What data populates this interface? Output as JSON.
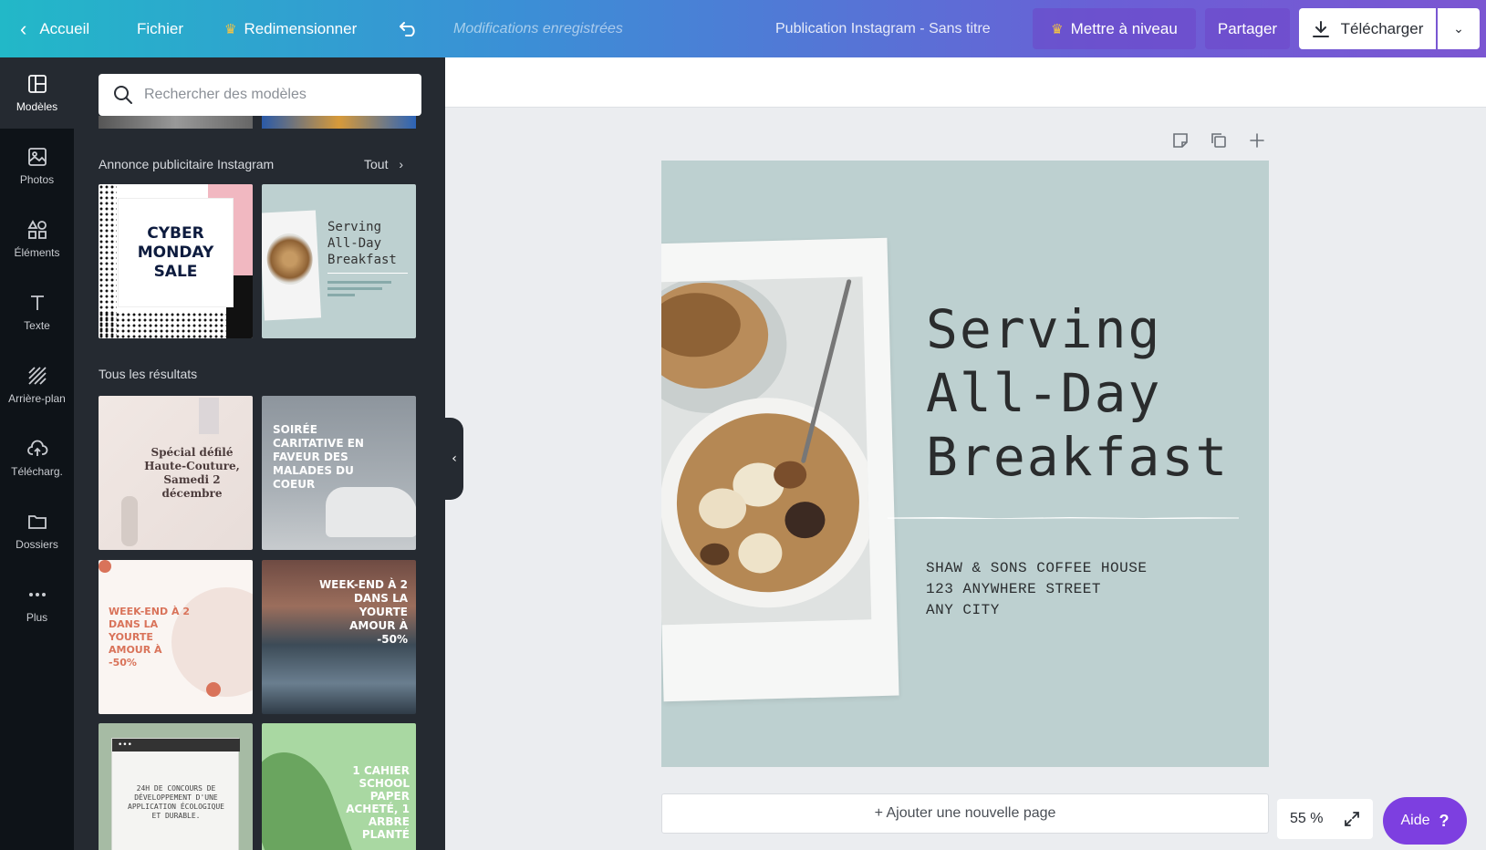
{
  "topbar": {
    "back_label": "Accueil",
    "file_label": "Fichier",
    "resize_label": "Redimensionner",
    "saved_status": "Modifications enregistrées",
    "document_title": "Publication Instagram - Sans titre",
    "upgrade_label": "Mettre à niveau",
    "share_label": "Partager",
    "download_label": "Télécharger"
  },
  "rail": {
    "items": [
      {
        "label": "Modèles",
        "icon": "templates-icon"
      },
      {
        "label": "Photos",
        "icon": "photos-icon"
      },
      {
        "label": "Éléments",
        "icon": "elements-icon"
      },
      {
        "label": "Texte",
        "icon": "text-icon"
      },
      {
        "label": "Arrière-plan",
        "icon": "background-icon"
      },
      {
        "label": "Télécharg.",
        "icon": "upload-icon"
      },
      {
        "label": "Dossiers",
        "icon": "folders-icon"
      },
      {
        "label": "Plus",
        "icon": "more-icon"
      }
    ]
  },
  "panel": {
    "search_placeholder": "Rechercher des modèles",
    "section1_title": "Annonce publicitaire Instagram",
    "section1_all": "Tout",
    "section2_title": "Tous les résultats",
    "thumbs": {
      "cyber": "CYBER MONDAY SALE",
      "serving": "Serving All-Day Breakfast",
      "defile": "Spécial défilé Haute-Couture, Samedi 2 décembre",
      "soiree": "SOIRÉE CARITATIVE EN FAVEUR DES MALADES DU COEUR",
      "weekend1": "WEEK-END À 2 DANS LA YOURTE AMOUR À -50%",
      "weekend2": "WEEK-END À 2 DANS LA YOURTE AMOUR À -50%",
      "concours": "24H DE CONCOURS DE DÉVELOPPEMENT D'UNE APPLICATION ÉCOLOGIQUE ET DURABLE.",
      "cahier": "1 CAHIER SCHOOL PAPER ACHETÉ, 1 ARBRE PLANTÉ"
    }
  },
  "design": {
    "headline_line1": "Serving",
    "headline_line2": "All-Day",
    "headline_line3": "Breakfast",
    "address_line1": "SHAW & SONS COFFEE HOUSE",
    "address_line2": "123 ANYWHERE STREET",
    "address_line3": "ANY CITY",
    "background_color": "#bdd0d0"
  },
  "footer": {
    "add_page_label": "+ Ajouter une nouvelle page",
    "zoom_level": "55 %",
    "help_label": "Aide"
  },
  "colors": {
    "accent_purple": "#7d3fe0",
    "rail_bg": "#0e1318",
    "panel_bg": "#252a31"
  }
}
